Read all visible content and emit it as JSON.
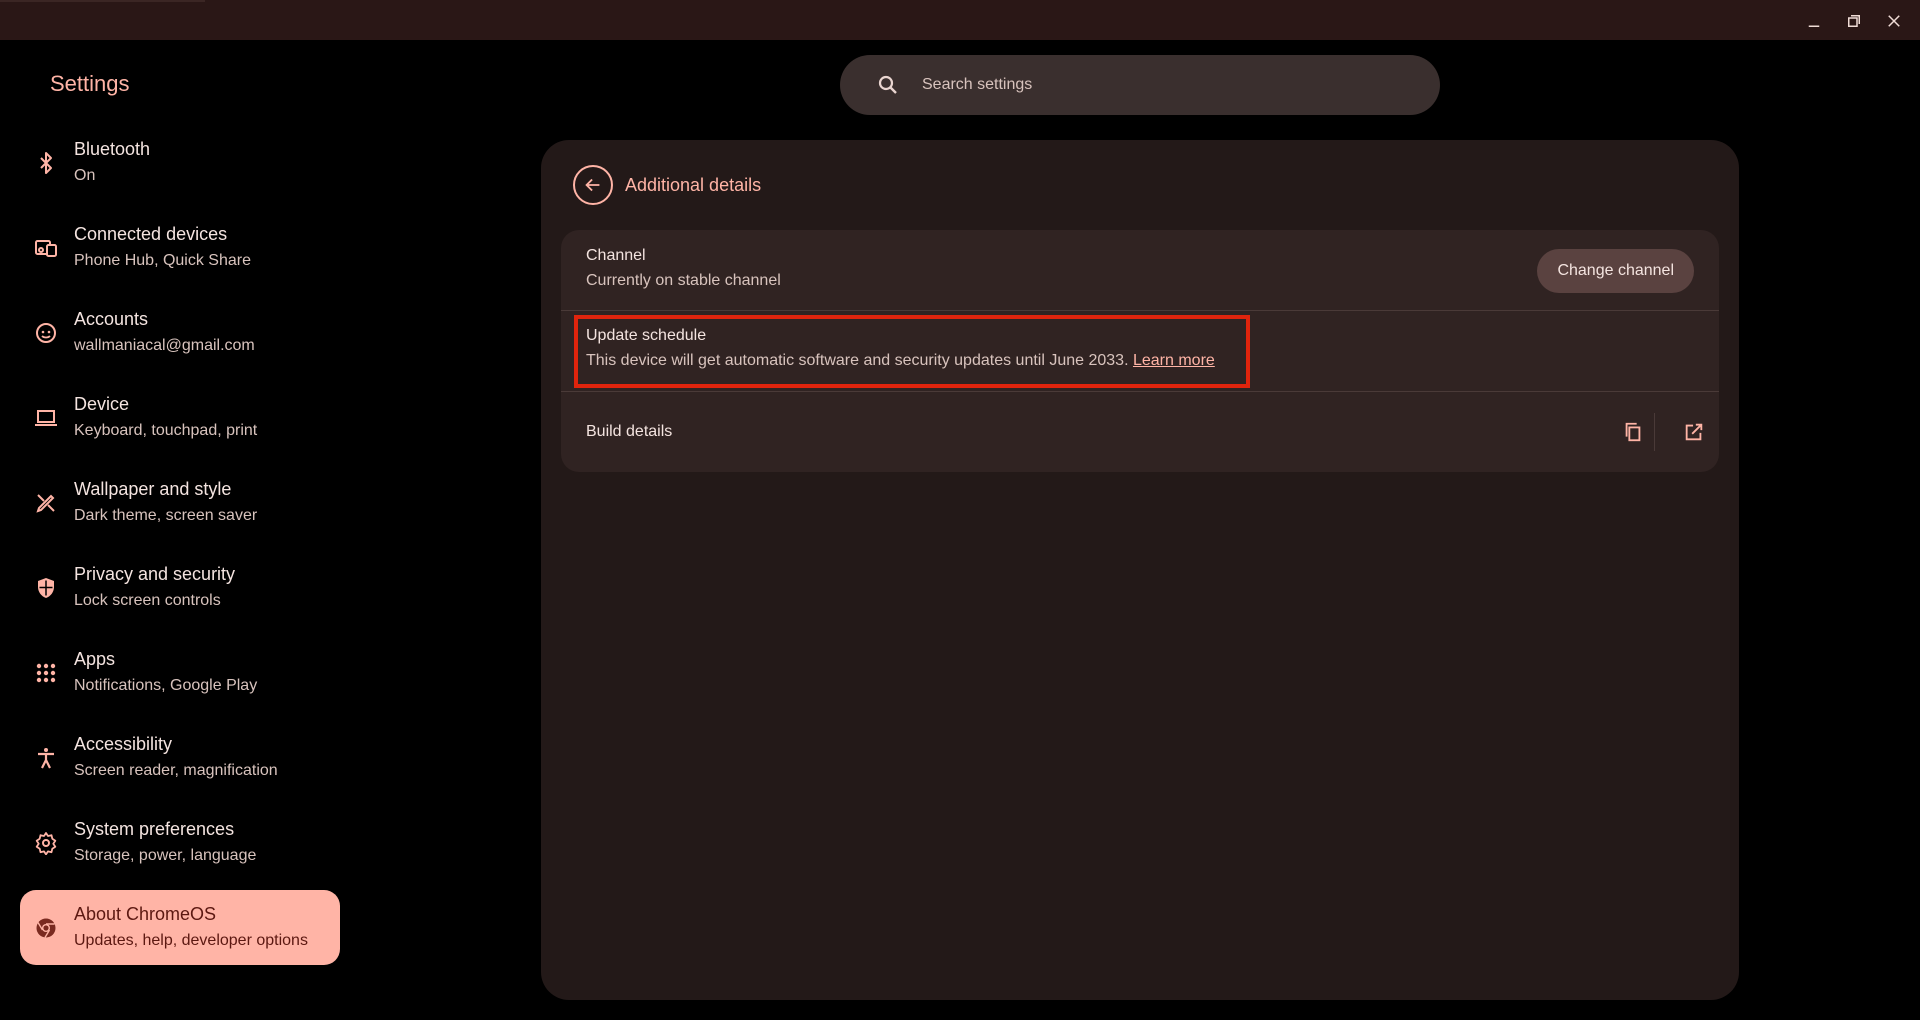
{
  "window": {
    "controls": [
      "minimize-icon",
      "restore-icon",
      "close-icon"
    ]
  },
  "app_title": "Settings",
  "search": {
    "placeholder": "Search settings"
  },
  "sidebar": {
    "items": [
      {
        "label": "Bluetooth",
        "sub": "On",
        "icon": "bluetooth-icon"
      },
      {
        "label": "Connected devices",
        "sub": "Phone Hub, Quick Share",
        "icon": "connected-devices-icon"
      },
      {
        "label": "Accounts",
        "sub": "wallmaniacal@gmail.com",
        "icon": "account-icon"
      },
      {
        "label": "Device",
        "sub": "Keyboard, touchpad, print",
        "icon": "laptop-icon"
      },
      {
        "label": "Wallpaper and style",
        "sub": "Dark theme, screen saver",
        "icon": "paint-icon"
      },
      {
        "label": "Privacy and security",
        "sub": "Lock screen controls",
        "icon": "shield-icon"
      },
      {
        "label": "Apps",
        "sub": "Notifications, Google Play",
        "icon": "apps-grid-icon"
      },
      {
        "label": "Accessibility",
        "sub": "Screen reader, magnification",
        "icon": "accessibility-icon"
      },
      {
        "label": "System preferences",
        "sub": "Storage, power, language",
        "icon": "gear-icon"
      },
      {
        "label": "About ChromeOS",
        "sub": "Updates, help, developer options",
        "icon": "chromeos-icon",
        "active": true
      }
    ]
  },
  "card": {
    "title": "Additional details",
    "channel": {
      "label": "Channel",
      "sub": "Currently on stable channel",
      "button": "Change channel"
    },
    "update": {
      "label": "Update schedule",
      "sub": "This device will get automatic software and security updates until June 2033.",
      "link": "Learn more"
    },
    "build": {
      "label": "Build details"
    }
  },
  "colors": {
    "accent": "#ffb4a6",
    "highlight_box": "#e0240d",
    "card_bg": "#231918",
    "group_bg": "#302322"
  }
}
